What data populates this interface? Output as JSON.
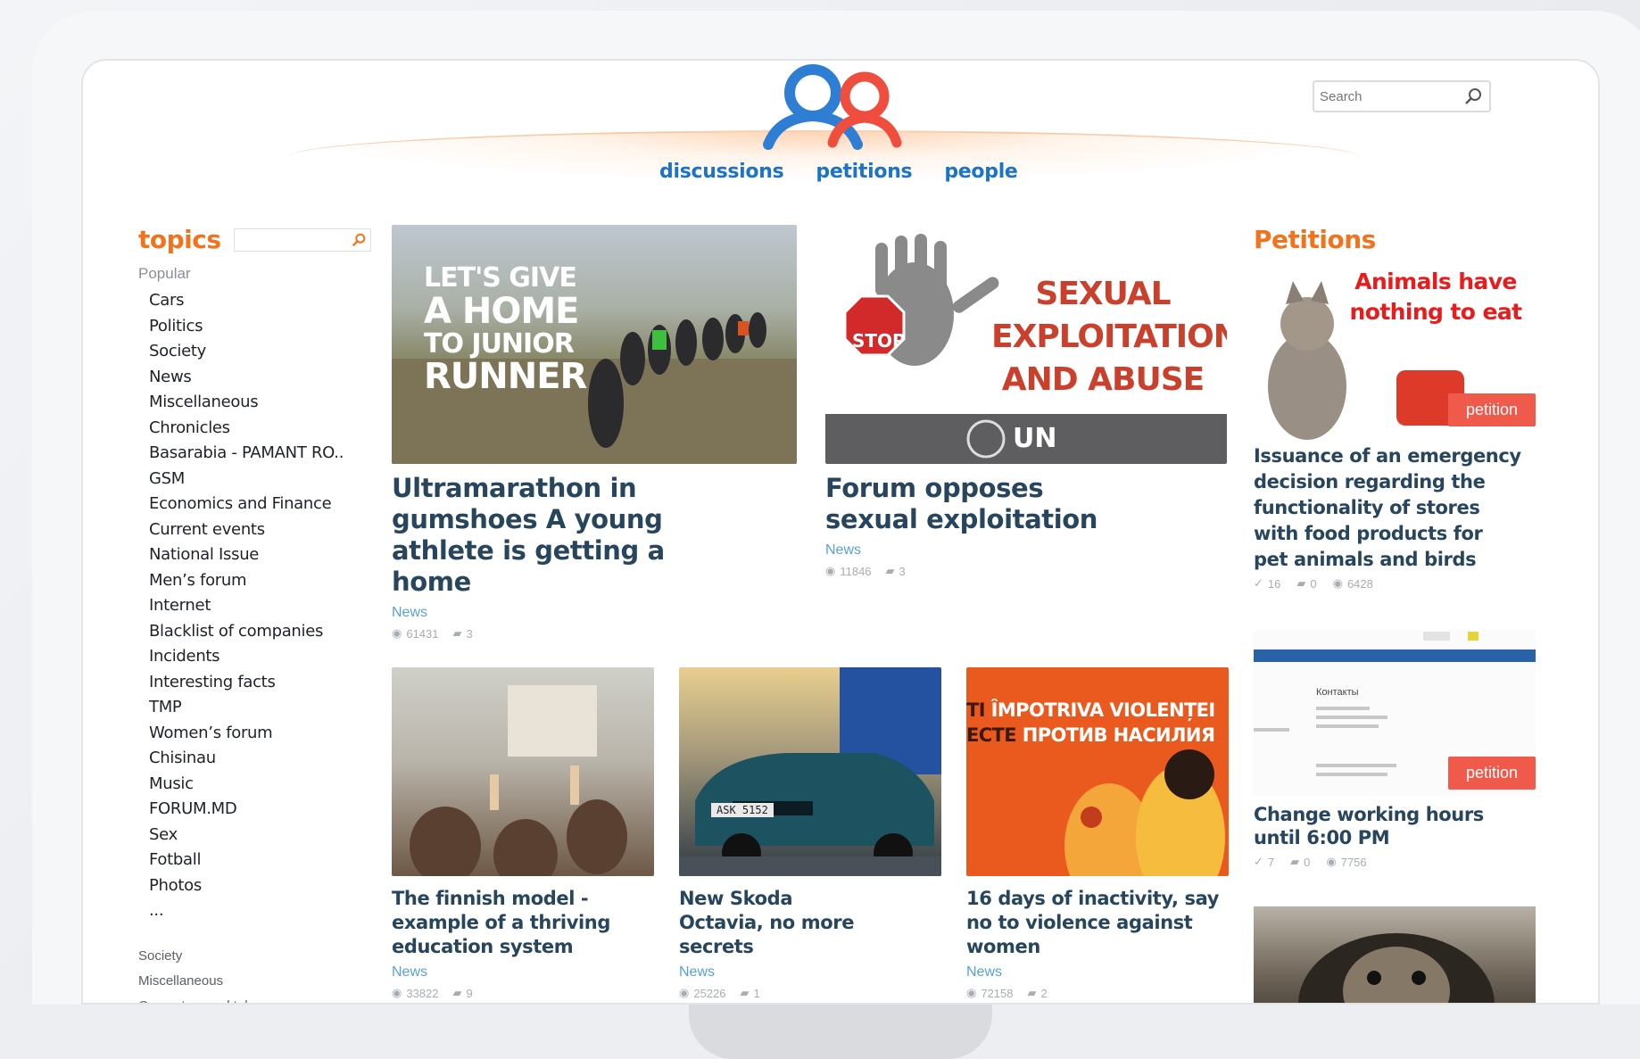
{
  "search": {
    "placeholder": "Search"
  },
  "nav": [
    "discussions",
    "petitions",
    "people"
  ],
  "sidebar": {
    "title": "topics",
    "popular_label": "Popular",
    "topics": [
      "Cars",
      "Politics",
      "Society",
      "News",
      "Miscellaneous",
      "Chronicles",
      "Basarabia - PAMANT RO..",
      "GSM",
      "Economics and Finance",
      "Current events",
      "National Issue",
      "Men’s forum",
      "Internet",
      "Blacklist of companies",
      "Incidents",
      "Interesting facts",
      "TMP",
      "Women’s forum",
      "Chisinau",
      "Music",
      "FORUM.MD",
      "Sex",
      "Fotball",
      "Photos",
      "..."
    ],
    "sections": [
      "Society",
      "Miscellaneous",
      "Computers and telecommu-"
    ]
  },
  "featured": [
    {
      "image_text": [
        "LET'S GIVE",
        "A HOME",
        "TO JUNIOR",
        "RUNNER"
      ],
      "title": "Ultramarathon in gumshoes A young athlete is getting a home",
      "category": "News",
      "views": "61431",
      "comments": "3"
    },
    {
      "image_text": [
        "SEXUAL",
        "EXPLOITATION",
        "AND ABUSE"
      ],
      "image_stop": "STOP",
      "image_un": "UN",
      "title": "Forum opposes sexual exploitation",
      "category": "News",
      "views": "11846",
      "comments": "3"
    }
  ],
  "articles": [
    {
      "title": "The finnish model - example of a thriving education system",
      "category": "News",
      "views": "33822",
      "comments": "9"
    },
    {
      "title": "New Skoda Octavia, no more secrets",
      "category": "News",
      "views": "25226",
      "comments": "1",
      "plate": "ASK 5152"
    },
    {
      "title": "16 days of inactivity, say no to violence against women",
      "category": "News",
      "views": "72158",
      "comments": "2",
      "image_line1": "ÎMPOTRIVA VIOLENȚEI",
      "image_line2": "ПРОТИВ НАСИЛИЯ",
      "image_prefix1": "TI",
      "image_prefix2": "ECTE"
    }
  ],
  "petitions": {
    "title": "Petitions",
    "items": [
      {
        "image_text": "Animals have nothing to eat",
        "badge": "petition",
        "title": "Issuance of an emergency decision regarding the functionality of stores with food products for pet animals and birds",
        "signatures": "16",
        "comments": "0",
        "views": "6428"
      },
      {
        "badge": "petition",
        "image_heading": "Контакты",
        "title": "Change working hours until 6:00 PM",
        "signatures": "7",
        "comments": "0",
        "views": "7756"
      }
    ]
  },
  "colors": {
    "brand_orange": "#f2731c",
    "link_blue": "#1b74c8",
    "title_navy": "#27465e",
    "badge_red": "#ef5a4a"
  }
}
